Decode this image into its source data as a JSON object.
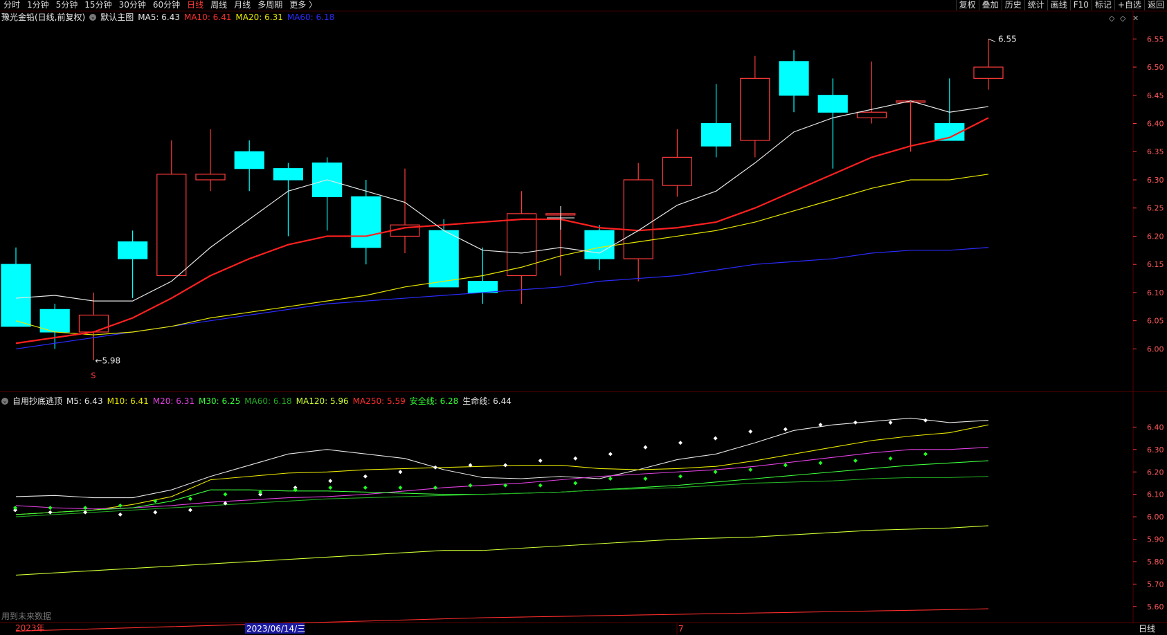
{
  "toolbar": {
    "periods": [
      "分时",
      "1分钟",
      "5分钟",
      "15分钟",
      "30分钟",
      "60分钟",
      "日线",
      "周线",
      "月线",
      "多周期",
      "更多 〉"
    ],
    "active_period": "日线",
    "right_tools": [
      "复权",
      "叠加",
      "历史",
      "统计",
      "画线",
      "F10",
      "标记",
      "+自选",
      "返回"
    ]
  },
  "main_legend": {
    "title": "豫光金铅(日线,前复权)",
    "subtitle": "默认主图",
    "items": [
      {
        "label": "MA5: 6.43",
        "color": "#e6e6e6"
      },
      {
        "label": "MA10: 6.41",
        "color": "#ff2d2d"
      },
      {
        "label": "MA20: 6.31",
        "color": "#e6e600"
      },
      {
        "label": "MA60: 6.18",
        "color": "#2b2bff"
      }
    ]
  },
  "sub_legend": {
    "title": "自用抄底逃顶",
    "items": [
      {
        "label": "M5: 6.43",
        "color": "#e6e6e6"
      },
      {
        "label": "M10: 6.41",
        "color": "#e6e600"
      },
      {
        "label": "M20: 6.31",
        "color": "#e040e0"
      },
      {
        "label": "M30: 6.25",
        "color": "#3cff3c"
      },
      {
        "label": "MA60: 6.18",
        "color": "#22aa22"
      },
      {
        "label": "MA120: 5.96",
        "color": "#ccff33"
      },
      {
        "label": "MA250: 5.59",
        "color": "#ff2d2d"
      },
      {
        "label": "安全线: 6.28",
        "color": "#33ff33"
      },
      {
        "label": "生命线: 6.44",
        "color": "#e6e6e6"
      }
    ]
  },
  "bottom": {
    "year_label": "2023年",
    "date_cursor": "2023/06/14/三",
    "month_mark": "7",
    "period_label": "日线",
    "note": "用到未来数据"
  },
  "colors": {
    "up": "#ff3b3b",
    "down": "#00ffff",
    "grid": "#5a0000",
    "axis": "#ff3b3b"
  },
  "chart_data": [
    {
      "type": "candlestick",
      "title": "豫光金铅(日线,前复权)",
      "x": [
        1,
        2,
        3,
        4,
        5,
        6,
        7,
        8,
        9,
        10,
        11,
        12,
        13,
        14,
        15,
        16,
        17,
        18,
        19,
        20,
        21,
        22,
        23,
        24,
        25,
        26
      ],
      "ohlc": [
        [
          6.15,
          6.18,
          6.04,
          6.04
        ],
        [
          6.07,
          6.08,
          6.0,
          6.03
        ],
        [
          6.03,
          6.1,
          5.98,
          6.06
        ],
        [
          6.19,
          6.21,
          6.09,
          6.16
        ],
        [
          6.13,
          6.37,
          6.13,
          6.31
        ],
        [
          6.3,
          6.39,
          6.28,
          6.31
        ],
        [
          6.35,
          6.37,
          6.28,
          6.32
        ],
        [
          6.32,
          6.33,
          6.2,
          6.3
        ],
        [
          6.33,
          6.34,
          6.21,
          6.27
        ],
        [
          6.27,
          6.3,
          6.15,
          6.18
        ],
        [
          6.2,
          6.32,
          6.17,
          6.22
        ],
        [
          6.21,
          6.23,
          6.11,
          6.11
        ],
        [
          6.12,
          6.18,
          6.08,
          6.1
        ],
        [
          6.13,
          6.28,
          6.08,
          6.24
        ],
        [
          6.24,
          6.24,
          6.13,
          6.24
        ],
        [
          6.21,
          6.22,
          6.14,
          6.16
        ],
        [
          6.16,
          6.33,
          6.12,
          6.3
        ],
        [
          6.29,
          6.39,
          6.27,
          6.34
        ],
        [
          6.4,
          6.47,
          6.34,
          6.36
        ],
        [
          6.37,
          6.52,
          6.34,
          6.48
        ],
        [
          6.51,
          6.53,
          6.42,
          6.45
        ],
        [
          6.45,
          6.48,
          6.32,
          6.42
        ],
        [
          6.41,
          6.51,
          6.4,
          6.42
        ],
        [
          6.44,
          6.44,
          6.35,
          6.44
        ],
        [
          6.4,
          6.48,
          6.37,
          6.37
        ],
        [
          6.48,
          6.55,
          6.46,
          6.5
        ]
      ],
      "ma5": [
        6.09,
        6.095,
        6.085,
        6.085,
        6.12,
        6.18,
        6.23,
        6.28,
        6.3,
        6.28,
        6.26,
        6.21,
        6.175,
        6.17,
        6.18,
        6.17,
        6.21,
        6.255,
        6.28,
        6.33,
        6.385,
        6.41,
        6.425,
        6.44,
        6.42,
        6.43
      ],
      "ma10": [
        6.01,
        6.02,
        6.03,
        6.055,
        6.09,
        6.13,
        6.16,
        6.185,
        6.2,
        6.2,
        6.215,
        6.22,
        6.225,
        6.23,
        6.23,
        6.215,
        6.21,
        6.215,
        6.225,
        6.25,
        6.28,
        6.31,
        6.34,
        6.36,
        6.375,
        6.41
      ],
      "ma20": [
        6.05,
        6.03,
        6.025,
        6.03,
        6.04,
        6.055,
        6.065,
        6.075,
        6.085,
        6.095,
        6.11,
        6.12,
        6.13,
        6.145,
        6.165,
        6.18,
        6.19,
        6.2,
        6.21,
        6.225,
        6.245,
        6.265,
        6.285,
        6.3,
        6.3,
        6.31
      ],
      "ma60": [
        6.0,
        6.01,
        6.02,
        6.03,
        6.04,
        6.05,
        6.06,
        6.07,
        6.08,
        6.085,
        6.09,
        6.095,
        6.1,
        6.105,
        6.11,
        6.12,
        6.125,
        6.13,
        6.14,
        6.15,
        6.155,
        6.16,
        6.17,
        6.175,
        6.175,
        6.18
      ],
      "annotations": [
        {
          "x": 3,
          "y": 5.98,
          "text": "←5.98"
        },
        {
          "x": 26,
          "y": 6.55,
          "text": "6.55"
        }
      ],
      "ylim": [
        5.96,
        6.57
      ],
      "yticks": [
        6.0,
        6.05,
        6.1,
        6.15,
        6.2,
        6.25,
        6.3,
        6.35,
        6.4,
        6.45,
        6.5,
        6.55
      ]
    },
    {
      "type": "line",
      "title": "自用抄底逃顶",
      "x": [
        1,
        2,
        3,
        4,
        5,
        6,
        7,
        8,
        9,
        10,
        11,
        12,
        13,
        14,
        15,
        16,
        17,
        18,
        19,
        20,
        21,
        22,
        23,
        24,
        25,
        26
      ],
      "series": [
        {
          "name": "M5",
          "values": [
            6.09,
            6.095,
            6.085,
            6.085,
            6.12,
            6.18,
            6.23,
            6.28,
            6.3,
            6.28,
            6.26,
            6.21,
            6.175,
            6.17,
            6.18,
            6.17,
            6.21,
            6.255,
            6.28,
            6.33,
            6.385,
            6.41,
            6.425,
            6.44,
            6.42,
            6.43
          ]
        },
        {
          "name": "M10",
          "values": [
            6.01,
            6.02,
            6.03,
            6.055,
            6.09,
            6.165,
            6.18,
            6.195,
            6.2,
            6.21,
            6.215,
            6.22,
            6.225,
            6.23,
            6.23,
            6.215,
            6.21,
            6.215,
            6.225,
            6.25,
            6.28,
            6.31,
            6.34,
            6.36,
            6.375,
            6.41
          ]
        },
        {
          "name": "M20",
          "values": [
            6.05,
            6.04,
            6.035,
            6.04,
            6.05,
            6.065,
            6.075,
            6.085,
            6.09,
            6.1,
            6.115,
            6.13,
            6.14,
            6.15,
            6.165,
            6.18,
            6.19,
            6.2,
            6.21,
            6.225,
            6.245,
            6.265,
            6.285,
            6.3,
            6.3,
            6.31
          ]
        },
        {
          "name": "M30",
          "values": [
            6.01,
            6.02,
            6.03,
            6.04,
            6.07,
            6.12,
            6.12,
            6.115,
            6.115,
            6.11,
            6.105,
            6.1,
            6.1,
            6.105,
            6.11,
            6.12,
            6.13,
            6.14,
            6.155,
            6.17,
            6.185,
            6.2,
            6.215,
            6.23,
            6.24,
            6.25
          ]
        },
        {
          "name": "MA60",
          "values": [
            6.0,
            6.01,
            6.02,
            6.03,
            6.04,
            6.05,
            6.06,
            6.07,
            6.08,
            6.085,
            6.09,
            6.095,
            6.1,
            6.105,
            6.11,
            6.12,
            6.125,
            6.13,
            6.14,
            6.15,
            6.155,
            6.16,
            6.17,
            6.175,
            6.175,
            6.18
          ]
        },
        {
          "name": "MA120",
          "values": [
            5.74,
            5.75,
            5.76,
            5.77,
            5.78,
            5.79,
            5.8,
            5.81,
            5.82,
            5.83,
            5.84,
            5.85,
            5.85,
            5.86,
            5.87,
            5.88,
            5.89,
            5.9,
            5.905,
            5.91,
            5.92,
            5.93,
            5.94,
            5.945,
            5.95,
            5.96
          ]
        },
        {
          "name": "MA250",
          "values": [
            5.49,
            5.495,
            5.5,
            5.505,
            5.51,
            5.515,
            5.52,
            5.525,
            5.53,
            5.535,
            5.54,
            5.545,
            5.55,
            5.553,
            5.556,
            5.559,
            5.562,
            5.565,
            5.568,
            5.571,
            5.574,
            5.577,
            5.58,
            5.583,
            5.586,
            5.59
          ]
        }
      ],
      "dots_white": [
        6.03,
        6.02,
        6.02,
        6.01,
        6.02,
        6.03,
        6.06,
        6.1,
        6.13,
        6.16,
        6.18,
        6.2,
        6.22,
        6.23,
        6.23,
        6.25,
        6.26,
        6.28,
        6.31,
        6.33,
        6.35,
        6.38,
        6.39,
        6.41,
        6.42,
        6.42,
        6.43
      ],
      "dots_green": [
        6.04,
        6.04,
        6.04,
        6.05,
        6.07,
        6.08,
        6.1,
        6.11,
        6.12,
        6.13,
        6.13,
        6.13,
        6.13,
        6.14,
        6.14,
        6.14,
        6.15,
        6.17,
        6.17,
        6.18,
        6.2,
        6.21,
        6.23,
        6.24,
        6.25,
        6.26,
        6.28
      ],
      "ylim": [
        5.55,
        6.5
      ],
      "yticks": [
        5.6,
        5.7,
        5.8,
        5.9,
        6.0,
        6.1,
        6.2,
        6.3,
        6.4
      ]
    }
  ]
}
